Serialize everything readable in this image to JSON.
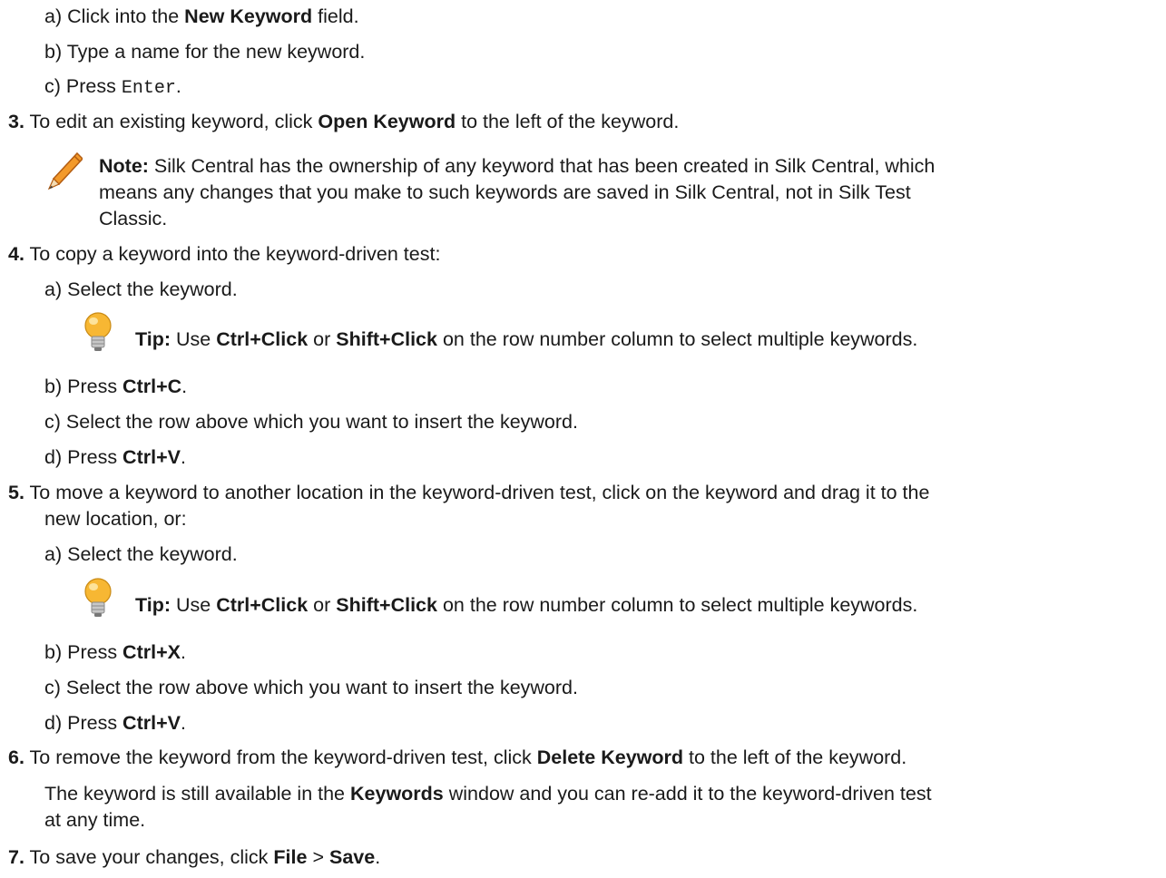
{
  "steps": {
    "s2a": {
      "label": "a)",
      "pre": "Click into the ",
      "b1": "New Keyword",
      "post": " field."
    },
    "s2b": {
      "label": "b)",
      "text": "Type a name for the new keyword."
    },
    "s2c": {
      "label": "c)",
      "pre": "Press ",
      "code": "Enter",
      "post": "."
    },
    "s3": {
      "num": "3.",
      "pre": "To edit an existing keyword, click ",
      "b1": "Open Keyword",
      "post": " to the left of the keyword."
    },
    "note": {
      "label": "Note:",
      "line1": " Silk Central has the ownership of any keyword that has been created in Silk Central, which",
      "line2": "means any changes that you make to such keywords are saved in Silk Central, not in Silk Test",
      "line3": "Classic."
    },
    "s4": {
      "num": "4.",
      "text": "To copy a keyword into the keyword-driven test:"
    },
    "s4a": {
      "label": "a)",
      "text": "Select the keyword."
    },
    "tip1": {
      "label": "Tip:",
      "pre": " Use ",
      "b1": "Ctrl+Click",
      "mid": " or ",
      "b2": "Shift+Click",
      "post": " on the row number column to select multiple keywords."
    },
    "s4b": {
      "label": "b)",
      "pre": "Press ",
      "b1": "Ctrl+C",
      "post": "."
    },
    "s4c": {
      "label": "c)",
      "text": "Select the row above which you want to insert the keyword."
    },
    "s4d": {
      "label": "d)",
      "pre": "Press ",
      "b1": "Ctrl+V",
      "post": "."
    },
    "s5": {
      "num": "5.",
      "line1": "To move a keyword to another location in the keyword-driven test, click on the keyword and drag it to the",
      "line2": "new location, or:"
    },
    "s5a": {
      "label": "a)",
      "text": "Select the keyword."
    },
    "tip2": {
      "label": "Tip:",
      "pre": " Use ",
      "b1": "Ctrl+Click",
      "mid": " or ",
      "b2": "Shift+Click",
      "post": " on the row number column to select multiple keywords."
    },
    "s5b": {
      "label": "b)",
      "pre": "Press ",
      "b1": "Ctrl+X",
      "post": "."
    },
    "s5c": {
      "label": "c)",
      "text": "Select the row above which you want to insert the keyword."
    },
    "s5d": {
      "label": "d)",
      "pre": "Press ",
      "b1": "Ctrl+V",
      "post": "."
    },
    "s6": {
      "num": "6.",
      "pre": "To remove the keyword from the keyword-driven test, click ",
      "b1": "Delete Keyword",
      "post": " to the left of the keyword."
    },
    "s6p": {
      "pre": "The keyword is still available in the ",
      "b1": "Keywords",
      "post": " window and you can re-add it to the keyword-driven test",
      "line2": "at any time."
    },
    "s7": {
      "num": "7.",
      "pre": "To save your changes, click ",
      "b1": "File",
      "mid": " > ",
      "b2": "Save",
      "post": "."
    }
  },
  "icons": {
    "note": "pencil-icon",
    "tip": "lightbulb-icon"
  },
  "colors": {
    "text": "#1a1a1a",
    "pencil": "#e8892b",
    "bulb": "#f5b62a"
  }
}
